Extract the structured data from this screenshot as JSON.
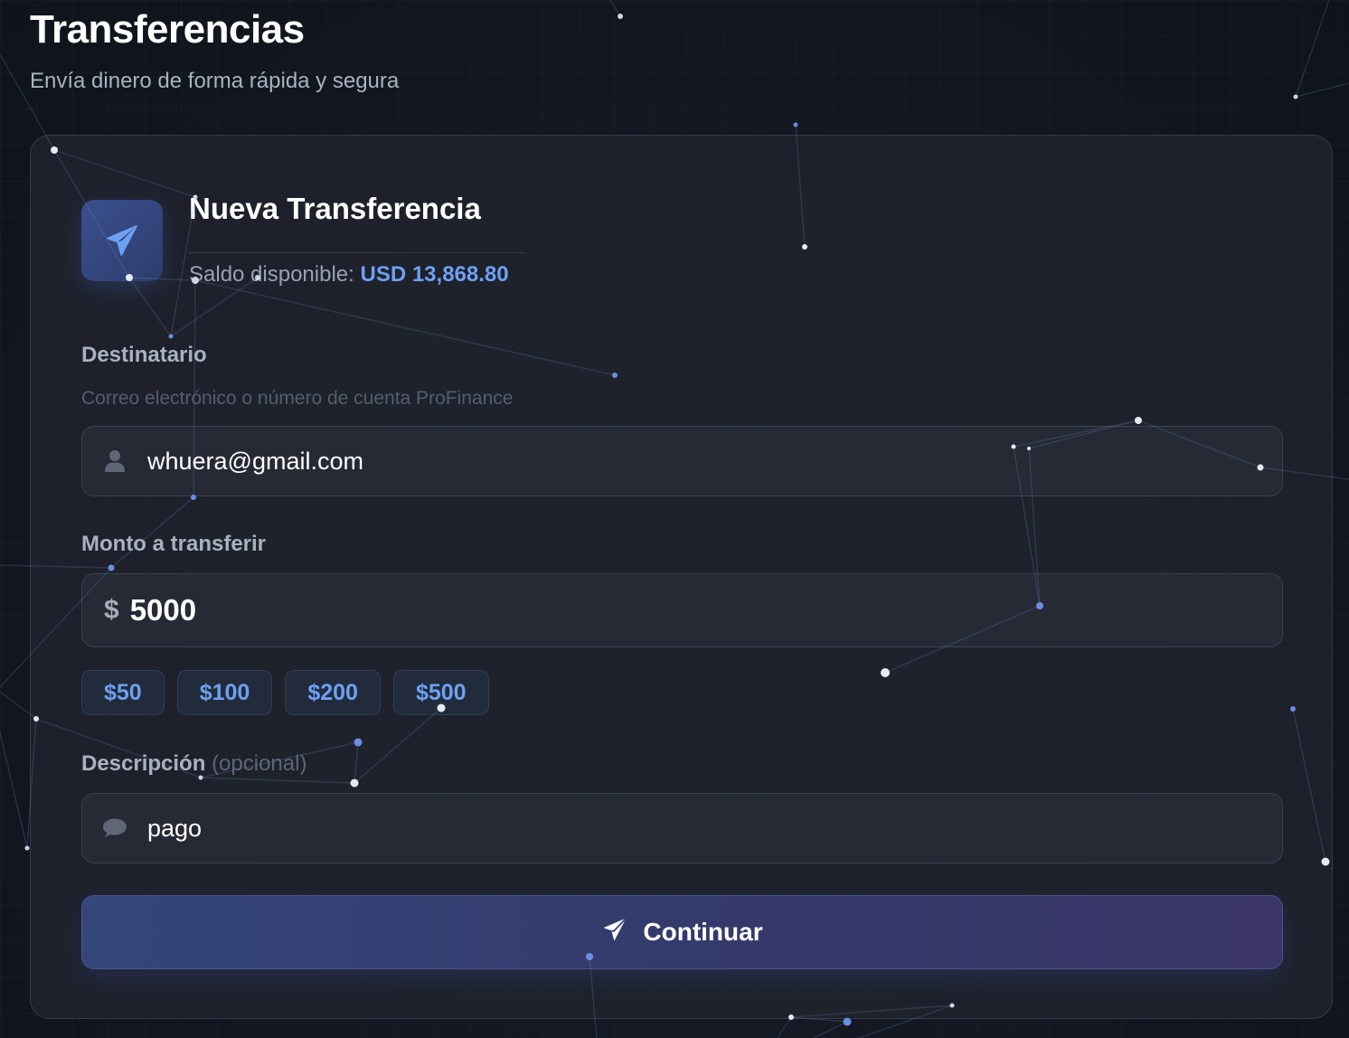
{
  "header": {
    "title": "Transferencias",
    "subtitle": "Envía dinero de forma rápida y segura"
  },
  "card": {
    "title": "Nueva Transferencia",
    "balance_label": "Saldo disponible:",
    "balance_value": "USD 13,868.80"
  },
  "recipient": {
    "label": "Destinatario",
    "hint": "Correo electrónico o número de cuenta ProFinance",
    "value": "whuera@gmail.com",
    "icon": "user-icon"
  },
  "amount": {
    "label": "Monto a transferir",
    "currency_symbol": "$",
    "value": "5000",
    "quick_amounts": [
      "$50",
      "$100",
      "$200",
      "$500"
    ]
  },
  "description": {
    "label": "Descripción",
    "optional_label": "(opcional)",
    "value": "pago",
    "icon": "comment-icon"
  },
  "submit": {
    "label": "Continuar",
    "icon": "paper-plane-icon"
  },
  "colors": {
    "accent": "#6ea0f2",
    "background": "#11151f",
    "card": "#1f232c",
    "button_start": "#34467c",
    "button_end": "#3a3566"
  }
}
